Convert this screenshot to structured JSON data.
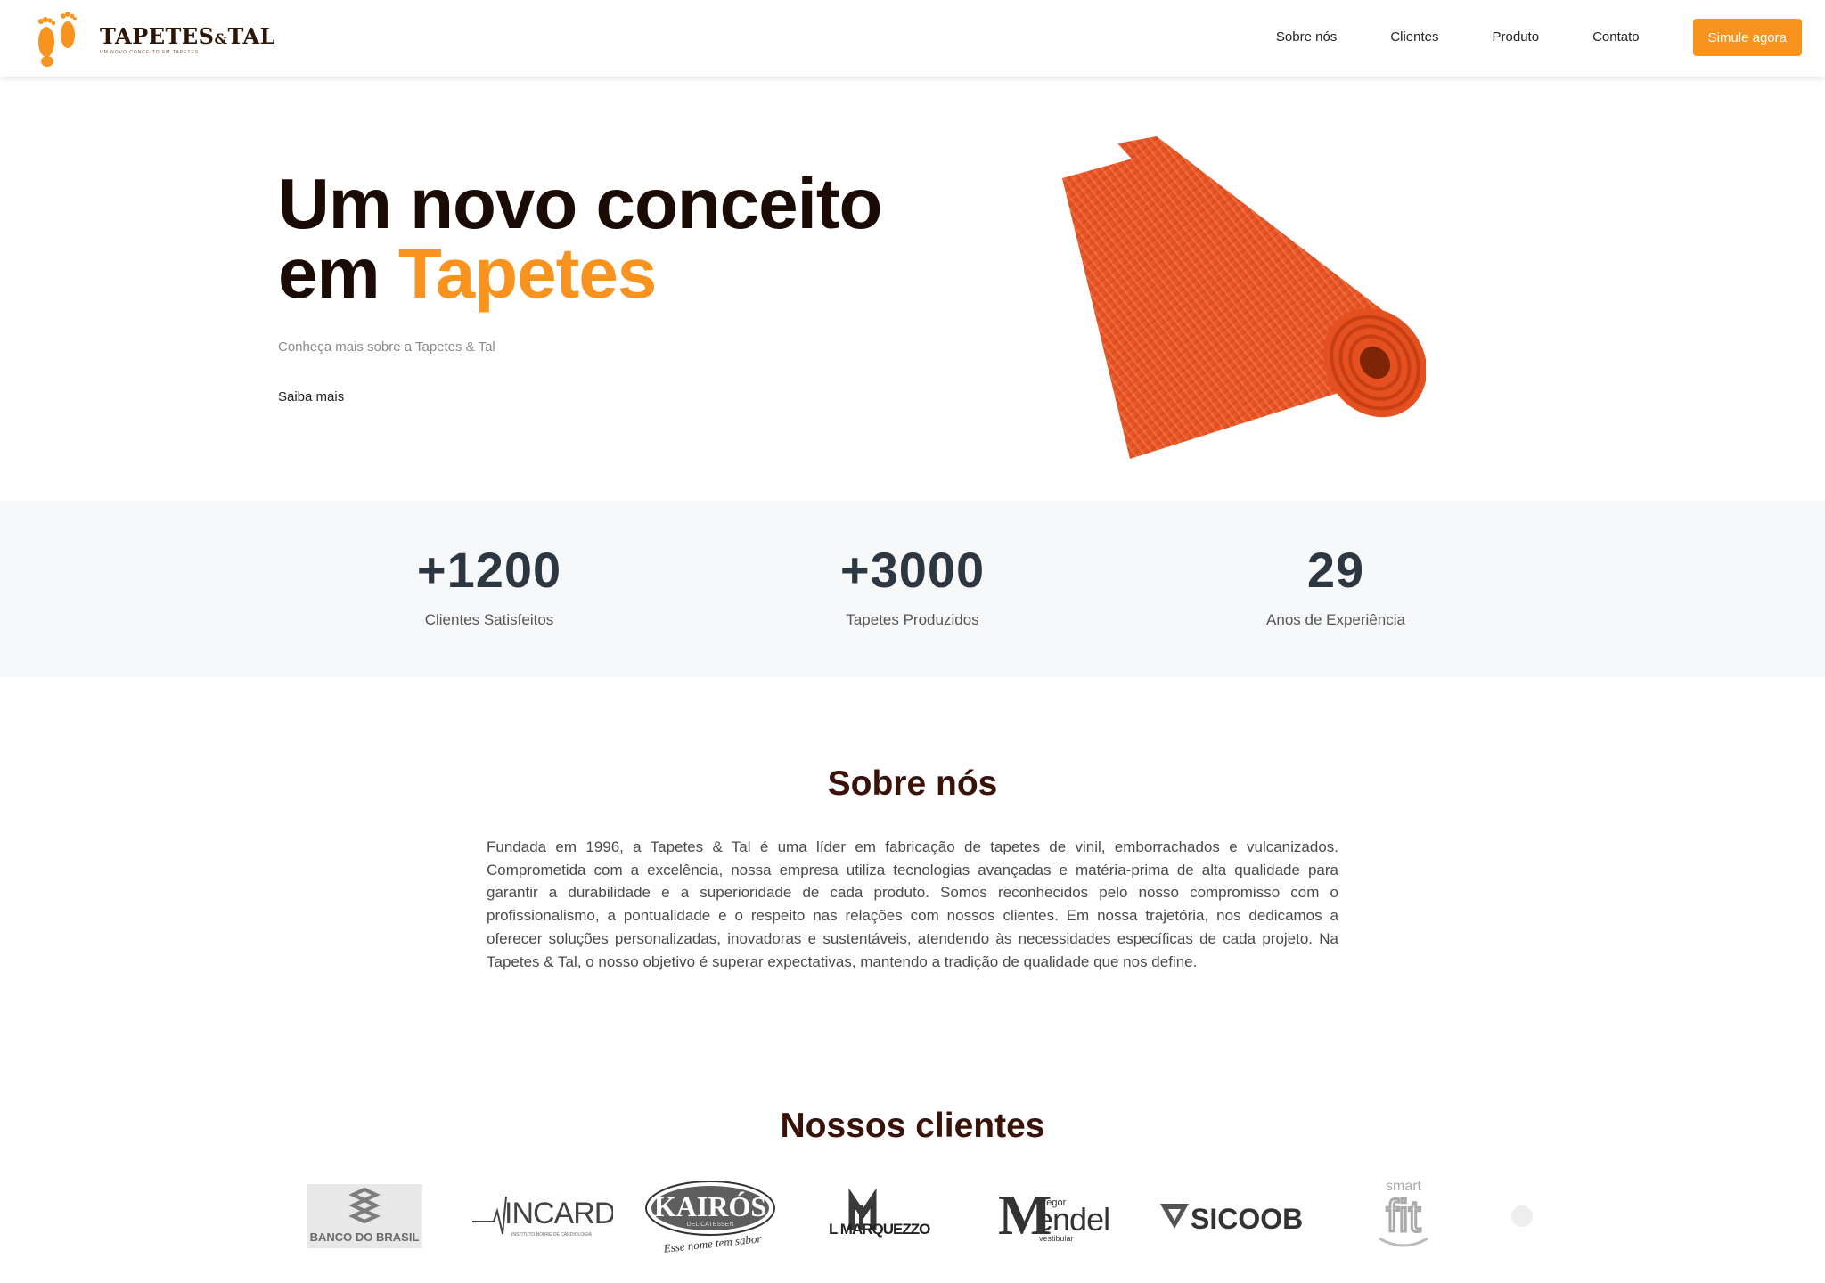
{
  "header": {
    "brand_name": "TAPETES",
    "brand_amp": "&",
    "brand_name2": "TAL",
    "brand_tagline": "UM NOVO CONCEITO EM TAPETES",
    "nav": [
      "Sobre nós",
      "Clientes",
      "Produto",
      "Contato"
    ],
    "cta": "Simule agora"
  },
  "hero": {
    "title_line1": "Um novo conceito",
    "title_line2_prefix": "em ",
    "title_line2_accent": "Tapetes",
    "subtitle": "Conheça mais sobre a Tapetes & Tal",
    "link": "Saiba mais",
    "image_icon": "rolled-mat-image"
  },
  "stats": [
    {
      "value": "+1200",
      "label": "Clientes Satisfeitos"
    },
    {
      "value": "+3000",
      "label": "Tapetes Produzidos"
    },
    {
      "value": "29",
      "label": "Anos de Experiência"
    }
  ],
  "about": {
    "title": "Sobre nós",
    "text": "Fundada em 1996, a Tapetes & Tal é uma líder em fabricação de tapetes de vinil, emborrachados e vulcanizados. Comprometida com a excelência, nossa empresa utiliza tecnologias avançadas e matéria-prima de alta qualidade para garantir a durabilidade e a superioridade de cada produto. Somos reconhecidos pelo nosso compromisso com o profissionalismo, a pontualidade e o respeito nas relações com nossos clientes. Em nossa trajetória, nos dedicamos a oferecer soluções personalizadas, inovadoras e sustentáveis, atendendo às necessidades específicas de cada projeto. Na Tapetes & Tal, o nosso objetivo é superar expectativas, mantendo a tradição de qualidade que nos define."
  },
  "clients": {
    "title": "Nossos clientes",
    "logos": [
      {
        "name": "BANCO DO BRASIL"
      },
      {
        "name": "INCARDIO",
        "sub": "INSTITUTO NOBRE DE CARDIOLOGIA"
      },
      {
        "name": "KAIRÓS",
        "sub": "DELICATESSEN",
        "tag": "Esse nome tem sabor"
      },
      {
        "name": "L MARQUEZZO"
      },
      {
        "name": "endel",
        "pre": "Gregor",
        "sub": "vestibular",
        "initial": "M"
      },
      {
        "name": "SICOOB"
      },
      {
        "name": "fit",
        "pre": "smart"
      }
    ]
  },
  "colors": {
    "accent": "#f7931e",
    "dark_brown": "#3a1208",
    "stats_bg": "#f7f8fa"
  }
}
